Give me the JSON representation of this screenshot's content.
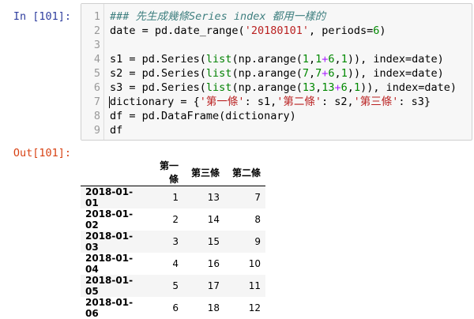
{
  "cells": {
    "in_prompt": "In [101]:",
    "out_prompt": "Out[101]:"
  },
  "code": {
    "lines": [
      {
        "n": "1",
        "segs": [
          {
            "t": "### 先生成幾條Series index 都用一樣的",
            "c": "comment"
          }
        ]
      },
      {
        "n": "2",
        "segs": [
          {
            "t": "date = pd.date_range(",
            "c": ""
          },
          {
            "t": "'20180101'",
            "c": "str"
          },
          {
            "t": ", periods=",
            "c": ""
          },
          {
            "t": "6",
            "c": "num"
          },
          {
            "t": ")",
            "c": ""
          }
        ]
      },
      {
        "n": "3",
        "segs": []
      },
      {
        "n": "4",
        "segs": [
          {
            "t": "s1 = pd.Series(",
            "c": ""
          },
          {
            "t": "list",
            "c": "builtin"
          },
          {
            "t": "(np.arange(",
            "c": ""
          },
          {
            "t": "1",
            "c": "num"
          },
          {
            "t": ",",
            "c": ""
          },
          {
            "t": "1",
            "c": "num"
          },
          {
            "t": "+",
            "c": "op"
          },
          {
            "t": "6",
            "c": "num"
          },
          {
            "t": ",",
            "c": ""
          },
          {
            "t": "1",
            "c": "num"
          },
          {
            "t": ")), index=date)",
            "c": ""
          }
        ]
      },
      {
        "n": "5",
        "segs": [
          {
            "t": "s2 = pd.Series(",
            "c": ""
          },
          {
            "t": "list",
            "c": "builtin"
          },
          {
            "t": "(np.arange(",
            "c": ""
          },
          {
            "t": "7",
            "c": "num"
          },
          {
            "t": ",",
            "c": ""
          },
          {
            "t": "7",
            "c": "num"
          },
          {
            "t": "+",
            "c": "op"
          },
          {
            "t": "6",
            "c": "num"
          },
          {
            "t": ",",
            "c": ""
          },
          {
            "t": "1",
            "c": "num"
          },
          {
            "t": ")), index=date)",
            "c": ""
          }
        ]
      },
      {
        "n": "6",
        "segs": [
          {
            "t": "s3 = pd.Series(",
            "c": ""
          },
          {
            "t": "list",
            "c": "builtin"
          },
          {
            "t": "(np.arange(",
            "c": ""
          },
          {
            "t": "13",
            "c": "num"
          },
          {
            "t": ",",
            "c": ""
          },
          {
            "t": "13",
            "c": "num"
          },
          {
            "t": "+",
            "c": "op"
          },
          {
            "t": "6",
            "c": "num"
          },
          {
            "t": ",",
            "c": ""
          },
          {
            "t": "1",
            "c": "num"
          },
          {
            "t": ")), index=date)",
            "c": ""
          }
        ]
      },
      {
        "n": "7",
        "cursor": true,
        "segs": [
          {
            "t": "dictionary = {",
            "c": ""
          },
          {
            "t": "'第一條'",
            "c": "str"
          },
          {
            "t": ": s1,",
            "c": ""
          },
          {
            "t": "'第二條'",
            "c": "str"
          },
          {
            "t": ": s2,",
            "c": ""
          },
          {
            "t": "'第三條'",
            "c": "str"
          },
          {
            "t": ": s3}",
            "c": ""
          }
        ]
      },
      {
        "n": "8",
        "segs": [
          {
            "t": "df = pd.DataFrame(dictionary)",
            "c": ""
          }
        ]
      },
      {
        "n": "9",
        "segs": [
          {
            "t": "df",
            "c": ""
          }
        ]
      }
    ]
  },
  "output": {
    "columns": [
      "第一條",
      "第三條",
      "第二條"
    ],
    "rows": [
      {
        "index": "2018-01-01",
        "values": [
          "1",
          "13",
          "7"
        ]
      },
      {
        "index": "2018-01-02",
        "values": [
          "2",
          "14",
          "8"
        ]
      },
      {
        "index": "2018-01-03",
        "values": [
          "3",
          "15",
          "9"
        ]
      },
      {
        "index": "2018-01-04",
        "values": [
          "4",
          "16",
          "10"
        ]
      },
      {
        "index": "2018-01-05",
        "values": [
          "5",
          "17",
          "11"
        ]
      },
      {
        "index": "2018-01-06",
        "values": [
          "6",
          "18",
          "12"
        ]
      }
    ]
  },
  "colors": {
    "in_prompt": "#303f9f",
    "out_prompt": "#d84315",
    "string": "#ba2121",
    "number": "#008800",
    "comment": "#408080",
    "builtin": "#008000",
    "operator": "#aa22ff"
  }
}
